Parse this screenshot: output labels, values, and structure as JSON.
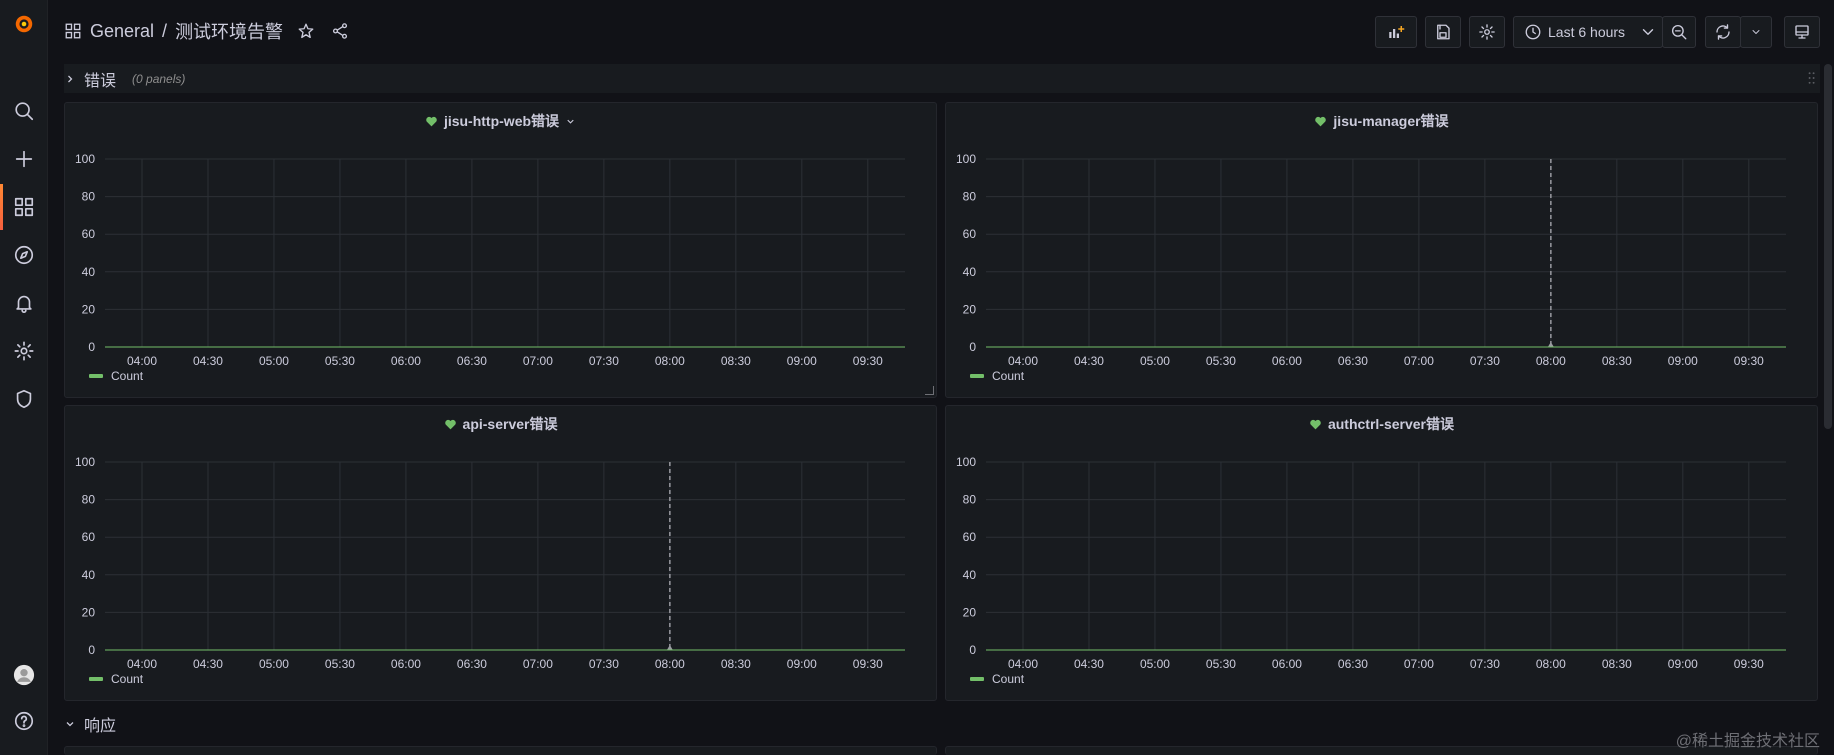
{
  "breadcrumb": {
    "folder": "General",
    "separator": "/",
    "dashboard": "测试环境告警"
  },
  "toolbar": {
    "time_range": "Last 6 hours"
  },
  "rows": [
    {
      "title": "错误",
      "panel_count": "(0 panels)"
    },
    {
      "title": "响应"
    }
  ],
  "x_ticks": [
    "04:00",
    "04:30",
    "05:00",
    "05:30",
    "06:00",
    "06:30",
    "07:00",
    "07:30",
    "08:00",
    "08:30",
    "09:00",
    "09:30"
  ],
  "y_ticks": [
    "100",
    "80",
    "60",
    "40",
    "20",
    "0"
  ],
  "panels": [
    {
      "title": "jisu-http-web错误",
      "legend": "Count",
      "marker": null
    },
    {
      "title": "jisu-manager错误",
      "legend": "Count",
      "marker": "08:00"
    },
    {
      "title": "api-server错误",
      "legend": "Count",
      "marker": "08:00"
    },
    {
      "title": "authctrl-server错误",
      "legend": "Count",
      "marker": null
    }
  ],
  "chart_data": [
    {
      "type": "line",
      "title": "jisu-http-web错误",
      "x": [
        "04:00",
        "04:30",
        "05:00",
        "05:30",
        "06:00",
        "06:30",
        "07:00",
        "07:30",
        "08:00",
        "08:30",
        "09:00",
        "09:30"
      ],
      "series": [
        {
          "name": "Count",
          "values": [
            0,
            0,
            0,
            0,
            0,
            0,
            0,
            0,
            0,
            0,
            0,
            0
          ]
        }
      ],
      "ylim": [
        0,
        100
      ]
    },
    {
      "type": "line",
      "title": "jisu-manager错误",
      "x": [
        "04:00",
        "04:30",
        "05:00",
        "05:30",
        "06:00",
        "06:30",
        "07:00",
        "07:30",
        "08:00",
        "08:30",
        "09:00",
        "09:30"
      ],
      "series": [
        {
          "name": "Count",
          "values": [
            0,
            0,
            0,
            0,
            0,
            0,
            0,
            0,
            0,
            0,
            0,
            0
          ]
        }
      ],
      "ylim": [
        0,
        100
      ]
    },
    {
      "type": "line",
      "title": "api-server错误",
      "x": [
        "04:00",
        "04:30",
        "05:00",
        "05:30",
        "06:00",
        "06:30",
        "07:00",
        "07:30",
        "08:00",
        "08:30",
        "09:00",
        "09:30"
      ],
      "series": [
        {
          "name": "Count",
          "values": [
            0,
            0,
            0,
            0,
            0,
            0,
            0,
            0,
            0,
            0,
            0,
            0
          ]
        }
      ],
      "ylim": [
        0,
        100
      ]
    },
    {
      "type": "line",
      "title": "authctrl-server错误",
      "x": [
        "04:00",
        "04:30",
        "05:00",
        "05:30",
        "06:00",
        "06:30",
        "07:00",
        "07:30",
        "08:00",
        "08:30",
        "09:00",
        "09:30"
      ],
      "series": [
        {
          "name": "Count",
          "values": [
            0,
            0,
            0,
            0,
            0,
            0,
            0,
            0,
            0,
            0,
            0,
            0
          ]
        }
      ],
      "ylim": [
        0,
        100
      ]
    }
  ],
  "colors": {
    "series": "#73bf69",
    "heart": "#73bf69",
    "accent": "#f55f3e"
  },
  "watermark": "@稀土掘金技术社区"
}
